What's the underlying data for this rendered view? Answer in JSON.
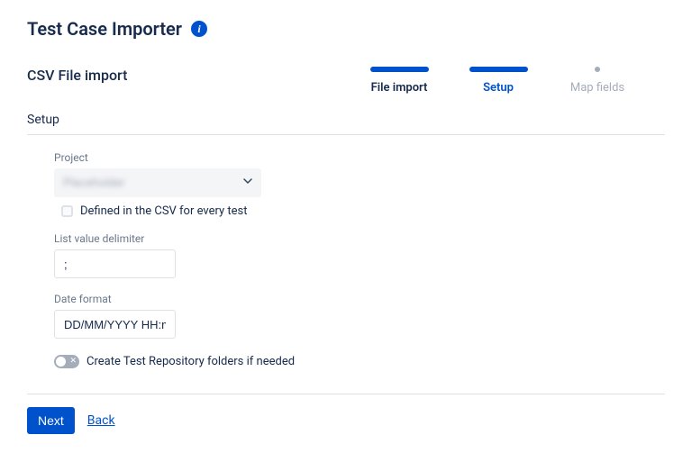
{
  "header": {
    "title": "Test Case Importer"
  },
  "subheader": {
    "title": "CSV File import"
  },
  "stepper": {
    "steps": [
      {
        "label": "File import",
        "state": "done"
      },
      {
        "label": "Setup",
        "state": "active"
      },
      {
        "label": "Map fields",
        "state": "future"
      }
    ]
  },
  "section": {
    "title": "Setup"
  },
  "form": {
    "project": {
      "label": "Project",
      "value": "Placeholder",
      "checkbox_label": "Defined in the CSV for every test"
    },
    "delimiter": {
      "label": "List value delimiter",
      "value": ";"
    },
    "dateformat": {
      "label": "Date format",
      "value": "DD/MM/YYYY HH:mm"
    },
    "create_folders": {
      "label": "Create Test Repository folders if needed"
    }
  },
  "footer": {
    "next": "Next",
    "back": "Back"
  }
}
